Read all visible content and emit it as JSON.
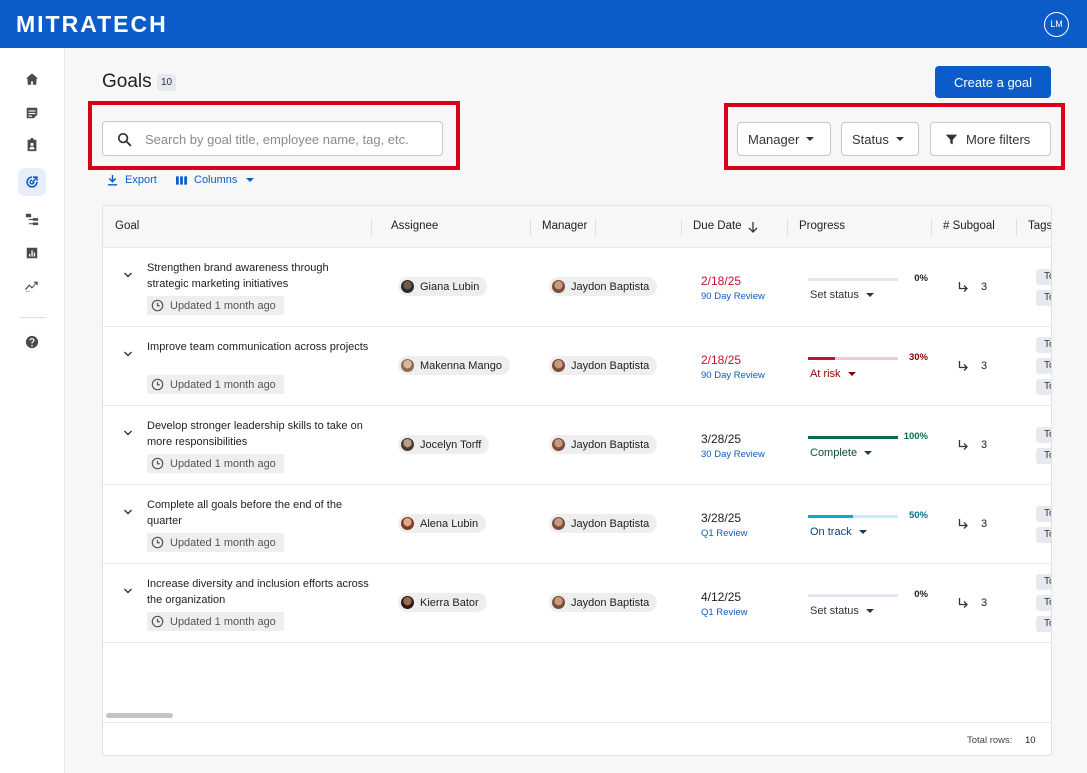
{
  "app": {
    "brand": "MITRATECH",
    "user_initials": "LM"
  },
  "sidebar": {
    "items": [
      {
        "icon": "home-icon",
        "active": false
      },
      {
        "icon": "notes-icon",
        "active": false
      },
      {
        "icon": "clipboard-icon",
        "active": false
      },
      {
        "icon": "goals-target-icon",
        "active": true
      },
      {
        "icon": "org-chart-icon",
        "active": false
      },
      {
        "icon": "bar-chart-icon",
        "active": false
      },
      {
        "icon": "trend-icon",
        "active": false
      },
      {
        "icon": "help-icon",
        "active": false
      }
    ]
  },
  "header": {
    "title": "Goals",
    "count": "10",
    "create_label": "Create a goal"
  },
  "search": {
    "placeholder": "Search by goal title, employee name, tag, etc."
  },
  "filters": {
    "manager": "Manager",
    "status": "Status",
    "more": "More filters"
  },
  "toolbar": {
    "export": "Export",
    "columns": "Columns"
  },
  "table": {
    "columns": [
      "Goal",
      "Assignee",
      "Manager",
      "Due Date",
      "Progress",
      "# Subgoal",
      "Tags"
    ],
    "rows": [
      {
        "title": "Strengthen brand awareness through strategic marketing initiatives",
        "updated": "Updated 1 month ago",
        "assignee": "Giana Lubin",
        "manager": "Jaydon Baptista",
        "due_date": "2/18/25",
        "review": "90 Day Review",
        "progress": 0,
        "progress_label": "0%",
        "status": "Set status",
        "subgoals": "3",
        "tags": [
          "To",
          "To"
        ]
      },
      {
        "title": "Improve team communication across projects",
        "updated": "Updated 1 month ago",
        "assignee": "Makenna Mango",
        "manager": "Jaydon Baptista",
        "due_date": "2/18/25",
        "review": "90 Day Review",
        "progress": 30,
        "progress_label": "30%",
        "status": "At risk",
        "subgoals": "3",
        "tags": [
          "To",
          "To",
          "To"
        ]
      },
      {
        "title": "Develop stronger leadership skills to take on more responsibilities",
        "updated": "Updated 1 month ago",
        "assignee": "Jocelyn Torff",
        "manager": "Jaydon Baptista",
        "due_date": "3/28/25",
        "review": "30 Day Review",
        "progress": 100,
        "progress_label": "100%",
        "status": "Complete",
        "subgoals": "3",
        "tags": [
          "To",
          "To"
        ]
      },
      {
        "title": "Complete all goals before the end of the quarter",
        "updated": "Updated 1 month ago",
        "assignee": "Alena Lubin",
        "manager": "Jaydon Baptista",
        "due_date": "3/28/25",
        "review": "Q1 Review",
        "progress": 50,
        "progress_label": "50%",
        "status": "On track",
        "subgoals": "3",
        "tags": [
          "To",
          "To"
        ]
      },
      {
        "title": "Increase diversity and inclusion efforts across the organization",
        "updated": "Updated 1 month ago",
        "assignee": "Kierra Bator",
        "manager": "Jaydon Baptista",
        "due_date": "4/12/25",
        "review": "Q1 Review",
        "progress": 0,
        "progress_label": "0%",
        "status": "Set status",
        "subgoals": "3",
        "tags": [
          "To",
          "To",
          "To"
        ]
      }
    ],
    "footer": {
      "total_label": "Total rows:",
      "total_value": "10"
    }
  },
  "colors": {
    "brand": "#0b5cc8",
    "highlight": "#d9001b",
    "overdue": "#c8102e",
    "at_risk": "#c8102e",
    "complete": "#0a6e46",
    "on_track": "#0ea5d8",
    "status_text_at_risk": "#8b0000"
  }
}
